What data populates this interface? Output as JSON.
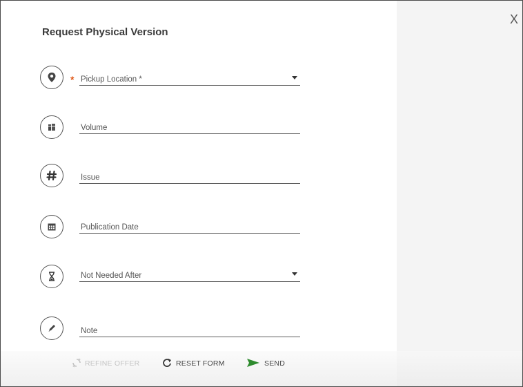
{
  "dialog": {
    "title": "Request Physical Version",
    "close_label": "X"
  },
  "form": {
    "fields": [
      {
        "id": "pickup",
        "label": "Pickup Location *",
        "icon": "map-pin-icon",
        "required": true,
        "dropdown": true
      },
      {
        "id": "volume",
        "label": "Volume",
        "icon": "books-icon",
        "required": false,
        "dropdown": false
      },
      {
        "id": "issue",
        "label": "Issue",
        "icon": "hash-icon",
        "required": false,
        "dropdown": false
      },
      {
        "id": "publication_date",
        "label": "Publication Date",
        "icon": "calendar-icon",
        "required": false,
        "dropdown": false
      },
      {
        "id": "not_needed_after",
        "label": "Not Needed After",
        "icon": "hourglass-icon",
        "required": false,
        "dropdown": true
      },
      {
        "id": "note",
        "label": "Note",
        "icon": "pencil-icon",
        "required": false,
        "dropdown": false
      }
    ],
    "required_marker": "*"
  },
  "footer": {
    "refine_label": "REFINE OFFER",
    "reset_label": "RESET FORM",
    "send_label": "SEND"
  },
  "colors": {
    "required": "#e05a1a",
    "send_icon": "#2e8b2e",
    "disabled": "#c4c4c4"
  }
}
